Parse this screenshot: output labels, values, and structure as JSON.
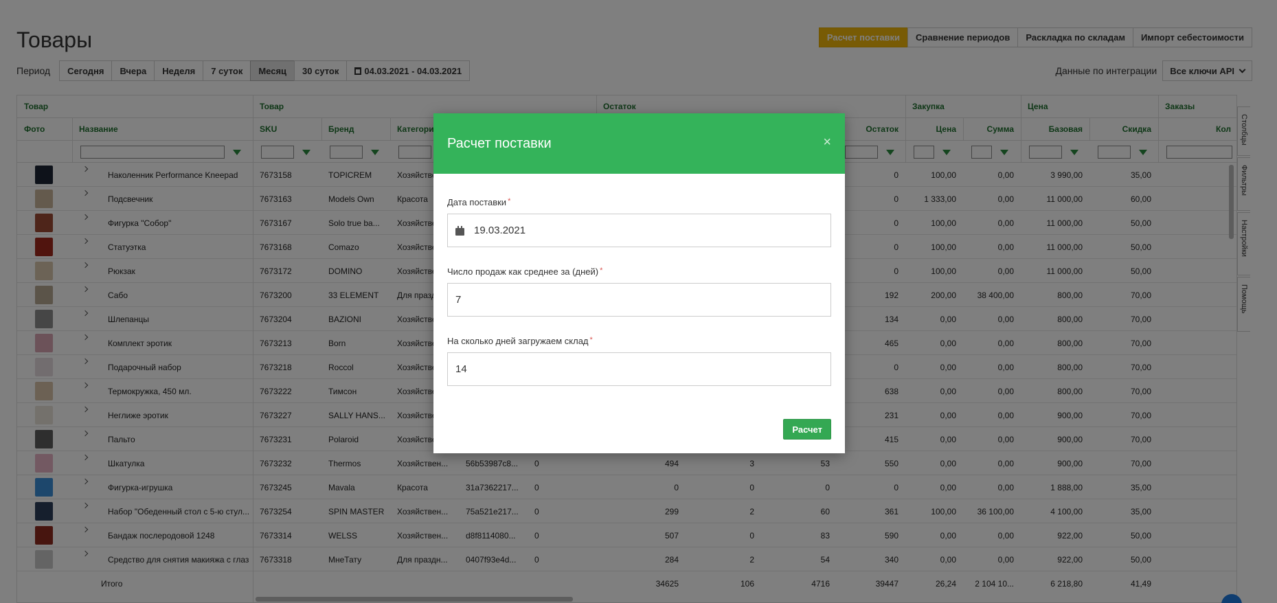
{
  "page": {
    "title": "Товары"
  },
  "top_actions": [
    {
      "label": "Расчет поставки",
      "active": true
    },
    {
      "label": "Сравнение периодов",
      "active": false
    },
    {
      "label": "Раскладка по складам",
      "active": false
    },
    {
      "label": "Импорт себестоимости",
      "active": false
    }
  ],
  "period": {
    "label": "Период",
    "buttons": [
      {
        "label": "Сегодня",
        "active": false
      },
      {
        "label": "Вчера",
        "active": false
      },
      {
        "label": "Неделя",
        "active": false
      },
      {
        "label": "7 суток",
        "active": false
      },
      {
        "label": "Месяц",
        "active": true
      },
      {
        "label": "30 суток",
        "active": false
      }
    ],
    "date_range": "04.03.2021 - 04.03.2021"
  },
  "integration": {
    "label": "Данные по интеграции",
    "selected": "Все ключи API"
  },
  "table": {
    "groups": [
      "Товар",
      "Товар",
      "Остаток",
      "Закупка",
      "Цена",
      "Заказы"
    ],
    "columns": [
      "Фото",
      "Название",
      "SKU",
      "Бренд",
      "Категори",
      "Остаток",
      "Цена",
      "Сумма",
      "Базовая",
      "Скидка",
      "Кол"
    ],
    "rows": [
      {
        "name": "Наколенник Performance Kneepad",
        "sku": "7673158",
        "brand": "TOPICREM",
        "category": "Хозяйстве",
        "id": "",
        "c5": "",
        "c6": "",
        "c7": "",
        "c8": "",
        "stock": "0",
        "price": "100,00",
        "sum": "0,00",
        "base": "3 990,00",
        "discount": "35,00",
        "photo": "#1d2434"
      },
      {
        "name": "Подсвечник",
        "sku": "7673163",
        "brand": "Models Own",
        "category": "Красота",
        "id": "",
        "c5": "",
        "c6": "",
        "c7": "",
        "c8": "",
        "stock": "0",
        "price": "1 333,00",
        "sum": "0,00",
        "base": "11 000,00",
        "discount": "60,00",
        "photo": "#c9b49a"
      },
      {
        "name": "Фигурка \"Собор\"",
        "sku": "7673167",
        "brand": "Solo true ba...",
        "category": "Хозяйстве",
        "id": "",
        "c5": "",
        "c6": "",
        "c7": "",
        "c8": "",
        "stock": "0",
        "price": "100,00",
        "sum": "0,00",
        "base": "11 000,00",
        "discount": "50,00",
        "photo": "#9c4a35"
      },
      {
        "name": "Статуэтка",
        "sku": "7673168",
        "brand": "Comazo",
        "category": "Хозяйстве",
        "id": "",
        "c5": "",
        "c6": "",
        "c7": "",
        "c8": "",
        "stock": "0",
        "price": "100,00",
        "sum": "0,00",
        "base": "11 000,00",
        "discount": "50,00",
        "photo": "#a0281d"
      },
      {
        "name": "Рюкзак",
        "sku": "7673172",
        "brand": "DOMINO",
        "category": "Хозяйстве",
        "id": "",
        "c5": "",
        "c6": "",
        "c7": "",
        "c8": "",
        "stock": "0",
        "price": "100,00",
        "sum": "0,00",
        "base": "11 000,00",
        "discount": "50,00",
        "photo": "#d8c7ad"
      },
      {
        "name": "Сабо",
        "sku": "7673200",
        "brand": "33 ELEMENT",
        "category": "Для празд",
        "id": "",
        "c5": "",
        "c6": "",
        "c7": "",
        "c8": "",
        "stock": "192",
        "price": "200,00",
        "sum": "38 400,00",
        "base": "800,00",
        "discount": "70,00",
        "photo": "#b7a993"
      },
      {
        "name": "Шлепанцы",
        "sku": "7673204",
        "brand": "BAZIONI",
        "category": "Хозяйстве",
        "id": "",
        "c5": "",
        "c6": "",
        "c7": "",
        "c8": "",
        "stock": "134",
        "price": "0,00",
        "sum": "0,00",
        "base": "800,00",
        "discount": "70,00",
        "photo": "#8d8d8d"
      },
      {
        "name": "Комплект эротик",
        "sku": "7673213",
        "brand": "Born",
        "category": "Хозяйстве",
        "id": "",
        "c5": "",
        "c6": "",
        "c7": "",
        "c8": "",
        "stock": "465",
        "price": "0,00",
        "sum": "0,00",
        "base": "800,00",
        "discount": "70,00",
        "photo": "#d9a5b3"
      },
      {
        "name": "Подарочный набор",
        "sku": "7673218",
        "brand": "Roccol",
        "category": "Хозяйстве",
        "id": "",
        "c5": "",
        "c6": "",
        "c7": "",
        "c8": "",
        "stock": "0",
        "price": "0,00",
        "sum": "0,00",
        "base": "800,00",
        "discount": "70,00",
        "photo": "#e5dadf"
      },
      {
        "name": "Термокружка, 450 мл.",
        "sku": "7673222",
        "brand": "Тимсон",
        "category": "Хозяйстве",
        "id": "",
        "c5": "",
        "c6": "",
        "c7": "",
        "c8": "",
        "stock": "638",
        "price": "0,00",
        "sum": "0,00",
        "base": "800,00",
        "discount": "70,00",
        "photo": "#d8c2a8"
      },
      {
        "name": "Неглиже эротик",
        "sku": "7673227",
        "brand": "SALLY HANS...",
        "category": "Хозяйстве",
        "id": "",
        "c5": "",
        "c6": "",
        "c7": "",
        "c8": "",
        "stock": "231",
        "price": "0,00",
        "sum": "0,00",
        "base": "900,00",
        "discount": "70,00",
        "photo": "#e8e2d8"
      },
      {
        "name": "Пальто",
        "sku": "7673231",
        "brand": "Polaroid",
        "category": "Хозяйстве",
        "id": "",
        "c5": "",
        "c6": "",
        "c7": "",
        "c8": "",
        "stock": "415",
        "price": "0,00",
        "sum": "0,00",
        "base": "900,00",
        "discount": "70,00",
        "photo": "#5c5c5c"
      },
      {
        "name": "Шкатулка",
        "sku": "7673232",
        "brand": "Thermos",
        "category": "Хозяйствен...",
        "id": "56b53987c8...",
        "c5": "0",
        "c6": "494",
        "c7": "3",
        "c8": "53",
        "stock": "550",
        "price": "0,00",
        "sum": "0,00",
        "base": "900,00",
        "discount": "70,00",
        "photo": "#e6b3c4"
      },
      {
        "name": "Фигурка-игрушка",
        "sku": "7673245",
        "brand": "Mavala",
        "category": "Красота",
        "id": "31a7362217...",
        "c5": "0",
        "c6": "0",
        "c7": "0",
        "c8": "0",
        "stock": "0",
        "price": "0,00",
        "sum": "0,00",
        "base": "1 888,00",
        "discount": "35,00",
        "photo": "#3b8fd8"
      },
      {
        "name": "Набор \"Обеденный стол с 5-ю стул...",
        "sku": "7673254",
        "brand": "SPIN MASTER",
        "category": "Хозяйствен...",
        "id": "75a521e217...",
        "c5": "0",
        "c6": "299",
        "c7": "2",
        "c8": "60",
        "stock": "361",
        "price": "100,00",
        "sum": "36 100,00",
        "base": "4 100,00",
        "discount": "35,00",
        "photo": "#2c3e5a"
      },
      {
        "name": "Бандаж послеродовой 1248",
        "sku": "7673314",
        "brand": "WELSS",
        "category": "Хозяйствен...",
        "id": "d8f8114080...",
        "c5": "0",
        "c6": "507",
        "c7": "0",
        "c8": "83",
        "stock": "590",
        "price": "0,00",
        "sum": "0,00",
        "base": "922,00",
        "discount": "50,00",
        "photo": "#8e2a1e"
      },
      {
        "name": "Средство для снятия макияжа с глаз",
        "sku": "7673318",
        "brand": "МнеТату",
        "category": "Для праздн...",
        "id": "0407f93e4d...",
        "c5": "0",
        "c6": "284",
        "c7": "2",
        "c8": "54",
        "stock": "340",
        "price": "0,00",
        "sum": "0,00",
        "base": "922,00",
        "discount": "50,00",
        "photo": "#c8c8c8"
      }
    ],
    "total": {
      "label": "Итого",
      "c6": "34625",
      "c7": "106",
      "c8": "4716",
      "stock": "39447",
      "price": "26,24",
      "sum": "2 104 10...",
      "base": "6 218,80",
      "discount": "41,49"
    }
  },
  "side_tabs": [
    "Столбцы",
    "Фильтры",
    "Настройки",
    "Помощь"
  ],
  "modal": {
    "title": "Расчет поставки",
    "close": "×",
    "required_mark": "*",
    "fields": [
      {
        "label": "Дата поставки",
        "value": "19.03.2021"
      },
      {
        "label": "Число продаж как среднее за (дней)",
        "value": "7"
      },
      {
        "label": "На сколько дней загружаем склад",
        "value": "14"
      }
    ],
    "submit": "Расчет"
  }
}
